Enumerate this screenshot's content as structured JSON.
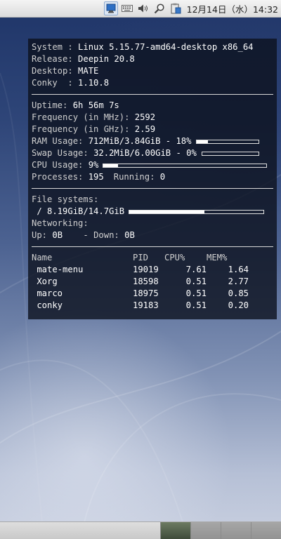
{
  "top_panel": {
    "icons": [
      "network-icon",
      "keyboard-icon",
      "volume-icon",
      "search-icon",
      "clipboard-icon"
    ],
    "clock": "12月14日（水）14:32"
  },
  "conky": {
    "system_label": "System : ",
    "system_value": "Linux 5.15.77-amd64-desktop x86_64",
    "release_label": "Release: ",
    "release_value": "Deepin 20.8",
    "desktop_label": "Desktop: ",
    "desktop_value": "MATE",
    "conky_label": "Conky  : ",
    "conky_value": "1.10.8",
    "uptime_label": "Uptime: ",
    "uptime_value": "6h 56m 7s",
    "freq_mhz_label": "Frequency (in MHz): ",
    "freq_mhz_value": "2592",
    "freq_ghz_label": "Frequency (in GHz): ",
    "freq_ghz_value": "2.59",
    "ram_label": "RAM Usage: ",
    "ram_value": "712MiB/3.84GiB - 18%",
    "ram_percent": 18,
    "swap_label": "Swap Usage: ",
    "swap_value": "32.2MiB/6.00GiB - 0%",
    "swap_percent": 0,
    "cpu_label": "CPU Usage: ",
    "cpu_value": "9%",
    "cpu_percent": 9,
    "processes_label": "Processes: ",
    "processes_value": "195",
    "running_label": "Running: ",
    "running_value": "0",
    "fs_label": "File systems:",
    "fs_value": " / 8.19GiB/14.7GiB",
    "fs_percent": 56,
    "networking_label": "Networking:",
    "up_label": "Up: ",
    "up_value": "0B",
    "down_label": "    - Down: ",
    "down_value": "0B",
    "process_table": {
      "headers": [
        "Name",
        "PID",
        "CPU%",
        "MEM%"
      ],
      "rows": [
        [
          " mate-menu",
          "19019",
          "7.61",
          "1.64"
        ],
        [
          " Xorg",
          "18598",
          "0.51",
          "2.77"
        ],
        [
          " marco",
          "18975",
          "0.51",
          "0.85"
        ],
        [
          " conky",
          "19183",
          "0.51",
          "0.20"
        ]
      ]
    }
  },
  "bottom_panel": {
    "workspaces": 4,
    "active_workspace": 1
  }
}
